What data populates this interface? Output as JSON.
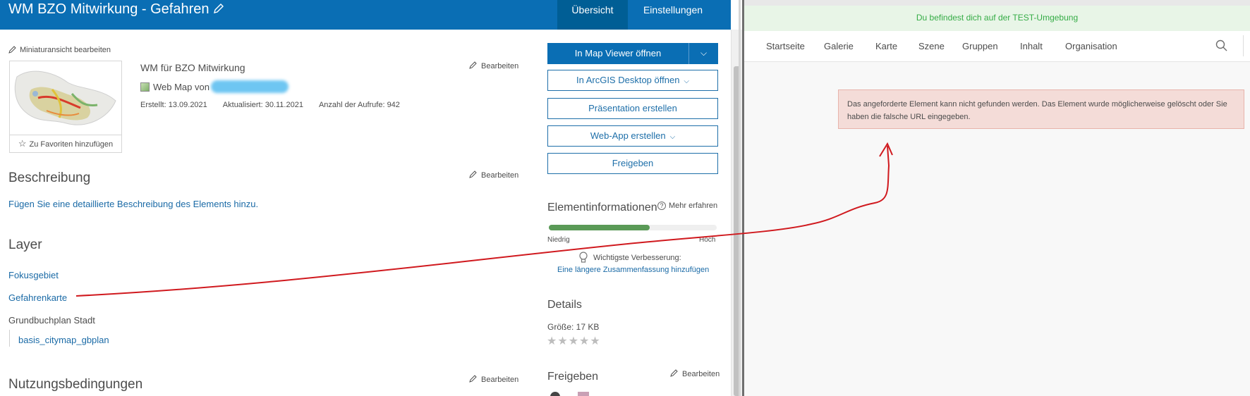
{
  "left": {
    "header": {
      "title": "WM BZO Mitwirkung - Gefahren",
      "tabs": [
        {
          "label": "Übersicht",
          "active": true
        },
        {
          "label": "Einstellungen",
          "active": false
        }
      ]
    },
    "thumbnail": {
      "edit_label": "Miniaturansicht bearbeiten",
      "favorite_label": "Zu Favoriten hinzufügen"
    },
    "item": {
      "name": "WM für BZO Mitwirkung",
      "type_label": "Web Map von",
      "created": "Erstellt: 13.09.2021",
      "updated": "Aktualisiert: 30.11.2021",
      "views": "Anzahl der Aufrufe: 942",
      "edit_label": "Bearbeiten"
    },
    "description": {
      "title": "Beschreibung",
      "edit_label": "Bearbeiten",
      "add_link": "Fügen Sie eine detaillierte Beschreibung des Elements hinzu."
    },
    "layers": {
      "title": "Layer",
      "items": [
        "Fokusgebiet",
        "Gefahrenkarte"
      ],
      "group": "Grundbuchplan Stadt",
      "sublayer": "basis_citymap_gbplan"
    },
    "terms": {
      "title": "Nutzungsbedingungen",
      "edit_label": "Bearbeiten"
    },
    "actions": {
      "map_viewer": "In Map Viewer öffnen",
      "arcgis_desktop": "In ArcGIS Desktop öffnen",
      "presentation": "Präsentation erstellen",
      "web_app": "Web-App erstellen",
      "share": "Freigeben"
    },
    "item_info": {
      "title": "Elementinformationen",
      "learn_more": "Mehr erfahren",
      "progress_fraction": 0.6,
      "low": "Niedrig",
      "high": "Hoch",
      "improve_label": "Wichtigste Verbesserung:",
      "improve_link": "Eine längere Zusammenfassung hinzufügen"
    },
    "details": {
      "title": "Details",
      "size": "Größe: 17 KB",
      "rating_stars": "★★★★★"
    },
    "sharing": {
      "title": "Freigeben",
      "edit_label": "Bearbeiten"
    }
  },
  "right": {
    "env_banner": "Du befindest dich auf der TEST-Umgebung",
    "nav": [
      "Startseite",
      "Galerie",
      "Karte",
      "Szene",
      "Gruppen",
      "Inhalt",
      "Organisation"
    ],
    "error_message": "Das angeforderte Element kann nicht gefunden werden. Das Element wurde möglicherweise gelöscht oder Sie haben die falsche URL eingegeben."
  },
  "colors": {
    "header_blue": "#0a6eb4",
    "link_blue": "#1a6aa6",
    "banner_green": "#35ac46",
    "error_bg": "#f4dcd8",
    "annotation_red": "#d0191e"
  }
}
